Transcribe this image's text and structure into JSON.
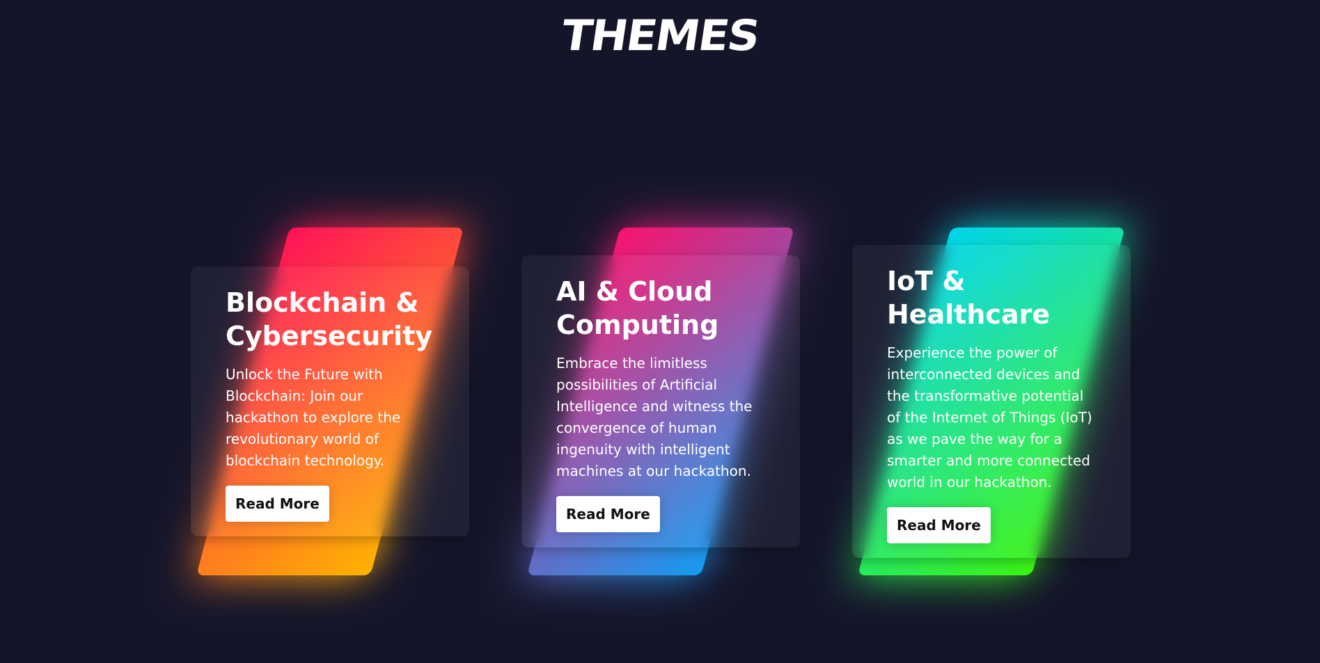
{
  "header": {
    "logo_text": "THEMES"
  },
  "cards": [
    {
      "title": "Blockchain & Cybersecurity",
      "description": "Unlock the Future with Blockchain: Join our hackathon to explore the revolutionary world of blockchain technology.",
      "button_label": "Read More",
      "gradient": [
        "#ff0f5b",
        "#ffb700"
      ]
    },
    {
      "title": "AI & Cloud Computing",
      "description": "Embrace the limitless possibilities of Artificial Intelligence and witness the convergence of human ingenuity with intelligent machines at our hackathon.",
      "button_label": "Read More",
      "gradient": [
        "#ff0f6a",
        "#0e9ff5"
      ]
    },
    {
      "title": "IoT & Healthcare",
      "description": "Experience the power of interconnected devices and the transformative potential of the Internet of Things (IoT) as we pave the way for a smarter and more connected world in our hackathon.",
      "button_label": "Read More",
      "gradient": [
        "#00d4f0",
        "#3cf50f"
      ]
    }
  ],
  "colors": {
    "background": "#15152a",
    "button_bg": "#ffffff",
    "button_text": "#111111"
  }
}
